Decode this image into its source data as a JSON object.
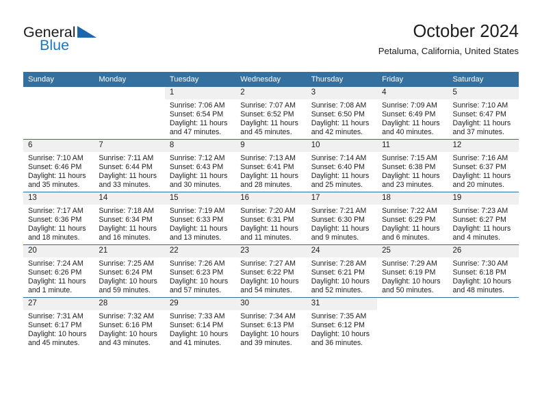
{
  "brand": {
    "name_top": "General",
    "name_bottom": "Blue",
    "triangle_color": "#1b66ae",
    "text_color": "#1b76bc"
  },
  "header": {
    "title": "October 2024",
    "location": "Petaluma, California, United States"
  },
  "colors": {
    "header_band": "#36709e",
    "row_divider": "#2a6ca4",
    "daynum_band": "#f0f0f0",
    "text": "#1c1c1c"
  },
  "weekday_headers": [
    "Sunday",
    "Monday",
    "Tuesday",
    "Wednesday",
    "Thursday",
    "Friday",
    "Saturday"
  ],
  "labels": {
    "sunrise_prefix": "Sunrise:",
    "sunset_prefix": "Sunset:",
    "daylight_prefix": "Daylight:"
  },
  "weeks": [
    [
      {
        "day": "",
        "blank": true,
        "lines": []
      },
      {
        "day": "",
        "blank": true,
        "lines": []
      },
      {
        "day": "1",
        "lines": [
          "Sunrise: 7:06 AM",
          "Sunset: 6:54 PM",
          "Daylight: 11 hours",
          "and 47 minutes."
        ]
      },
      {
        "day": "2",
        "lines": [
          "Sunrise: 7:07 AM",
          "Sunset: 6:52 PM",
          "Daylight: 11 hours",
          "and 45 minutes."
        ]
      },
      {
        "day": "3",
        "lines": [
          "Sunrise: 7:08 AM",
          "Sunset: 6:50 PM",
          "Daylight: 11 hours",
          "and 42 minutes."
        ]
      },
      {
        "day": "4",
        "lines": [
          "Sunrise: 7:09 AM",
          "Sunset: 6:49 PM",
          "Daylight: 11 hours",
          "and 40 minutes."
        ]
      },
      {
        "day": "5",
        "lines": [
          "Sunrise: 7:10 AM",
          "Sunset: 6:47 PM",
          "Daylight: 11 hours",
          "and 37 minutes."
        ]
      }
    ],
    [
      {
        "day": "6",
        "lines": [
          "Sunrise: 7:10 AM",
          "Sunset: 6:46 PM",
          "Daylight: 11 hours",
          "and 35 minutes."
        ]
      },
      {
        "day": "7",
        "lines": [
          "Sunrise: 7:11 AM",
          "Sunset: 6:44 PM",
          "Daylight: 11 hours",
          "and 33 minutes."
        ]
      },
      {
        "day": "8",
        "lines": [
          "Sunrise: 7:12 AM",
          "Sunset: 6:43 PM",
          "Daylight: 11 hours",
          "and 30 minutes."
        ]
      },
      {
        "day": "9",
        "lines": [
          "Sunrise: 7:13 AM",
          "Sunset: 6:41 PM",
          "Daylight: 11 hours",
          "and 28 minutes."
        ]
      },
      {
        "day": "10",
        "lines": [
          "Sunrise: 7:14 AM",
          "Sunset: 6:40 PM",
          "Daylight: 11 hours",
          "and 25 minutes."
        ]
      },
      {
        "day": "11",
        "lines": [
          "Sunrise: 7:15 AM",
          "Sunset: 6:38 PM",
          "Daylight: 11 hours",
          "and 23 minutes."
        ]
      },
      {
        "day": "12",
        "lines": [
          "Sunrise: 7:16 AM",
          "Sunset: 6:37 PM",
          "Daylight: 11 hours",
          "and 20 minutes."
        ]
      }
    ],
    [
      {
        "day": "13",
        "lines": [
          "Sunrise: 7:17 AM",
          "Sunset: 6:36 PM",
          "Daylight: 11 hours",
          "and 18 minutes."
        ]
      },
      {
        "day": "14",
        "lines": [
          "Sunrise: 7:18 AM",
          "Sunset: 6:34 PM",
          "Daylight: 11 hours",
          "and 16 minutes."
        ]
      },
      {
        "day": "15",
        "lines": [
          "Sunrise: 7:19 AM",
          "Sunset: 6:33 PM",
          "Daylight: 11 hours",
          "and 13 minutes."
        ]
      },
      {
        "day": "16",
        "lines": [
          "Sunrise: 7:20 AM",
          "Sunset: 6:31 PM",
          "Daylight: 11 hours",
          "and 11 minutes."
        ]
      },
      {
        "day": "17",
        "lines": [
          "Sunrise: 7:21 AM",
          "Sunset: 6:30 PM",
          "Daylight: 11 hours",
          "and 9 minutes."
        ]
      },
      {
        "day": "18",
        "lines": [
          "Sunrise: 7:22 AM",
          "Sunset: 6:29 PM",
          "Daylight: 11 hours",
          "and 6 minutes."
        ]
      },
      {
        "day": "19",
        "lines": [
          "Sunrise: 7:23 AM",
          "Sunset: 6:27 PM",
          "Daylight: 11 hours",
          "and 4 minutes."
        ]
      }
    ],
    [
      {
        "day": "20",
        "lines": [
          "Sunrise: 7:24 AM",
          "Sunset: 6:26 PM",
          "Daylight: 11 hours",
          "and 1 minute."
        ]
      },
      {
        "day": "21",
        "lines": [
          "Sunrise: 7:25 AM",
          "Sunset: 6:24 PM",
          "Daylight: 10 hours",
          "and 59 minutes."
        ]
      },
      {
        "day": "22",
        "lines": [
          "Sunrise: 7:26 AM",
          "Sunset: 6:23 PM",
          "Daylight: 10 hours",
          "and 57 minutes."
        ]
      },
      {
        "day": "23",
        "lines": [
          "Sunrise: 7:27 AM",
          "Sunset: 6:22 PM",
          "Daylight: 10 hours",
          "and 54 minutes."
        ]
      },
      {
        "day": "24",
        "lines": [
          "Sunrise: 7:28 AM",
          "Sunset: 6:21 PM",
          "Daylight: 10 hours",
          "and 52 minutes."
        ]
      },
      {
        "day": "25",
        "lines": [
          "Sunrise: 7:29 AM",
          "Sunset: 6:19 PM",
          "Daylight: 10 hours",
          "and 50 minutes."
        ]
      },
      {
        "day": "26",
        "lines": [
          "Sunrise: 7:30 AM",
          "Sunset: 6:18 PM",
          "Daylight: 10 hours",
          "and 48 minutes."
        ]
      }
    ],
    [
      {
        "day": "27",
        "lines": [
          "Sunrise: 7:31 AM",
          "Sunset: 6:17 PM",
          "Daylight: 10 hours",
          "and 45 minutes."
        ]
      },
      {
        "day": "28",
        "lines": [
          "Sunrise: 7:32 AM",
          "Sunset: 6:16 PM",
          "Daylight: 10 hours",
          "and 43 minutes."
        ]
      },
      {
        "day": "29",
        "lines": [
          "Sunrise: 7:33 AM",
          "Sunset: 6:14 PM",
          "Daylight: 10 hours",
          "and 41 minutes."
        ]
      },
      {
        "day": "30",
        "lines": [
          "Sunrise: 7:34 AM",
          "Sunset: 6:13 PM",
          "Daylight: 10 hours",
          "and 39 minutes."
        ]
      },
      {
        "day": "31",
        "lines": [
          "Sunrise: 7:35 AM",
          "Sunset: 6:12 PM",
          "Daylight: 10 hours",
          "and 36 minutes."
        ]
      },
      {
        "day": "",
        "blank": true,
        "lines": []
      },
      {
        "day": "",
        "blank": true,
        "lines": []
      }
    ]
  ]
}
